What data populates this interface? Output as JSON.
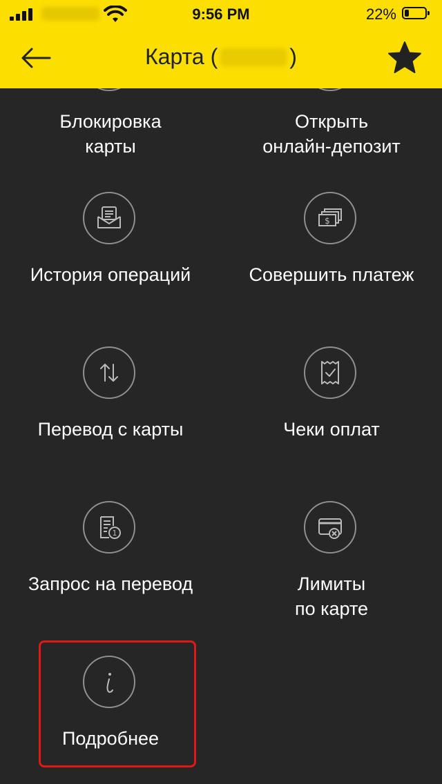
{
  "status_bar": {
    "time": "9:56 PM",
    "battery_percent": "22%",
    "battery_level": 0.22,
    "signal_icon": "cellular-signal-icon",
    "wifi_icon": "wifi-icon",
    "battery_icon": "battery-icon"
  },
  "header": {
    "title_prefix": "Карта (",
    "title_suffix": ")",
    "back_icon": "arrow-left-icon",
    "favorite_icon": "star-icon",
    "background_color": "#fcde00"
  },
  "actions": [
    {
      "id": "block-card",
      "label": "Блокировка\nкарты",
      "icon": "lock-icon"
    },
    {
      "id": "open-deposit",
      "label": "Открыть\nонлайн-депозит",
      "icon": "deposit-icon"
    },
    {
      "id": "history",
      "label": "История операций",
      "icon": "envelope-receipt-icon"
    },
    {
      "id": "payment",
      "label": "Совершить платеж",
      "icon": "banknotes-icon"
    },
    {
      "id": "transfer",
      "label": "Перевод с карты",
      "icon": "arrows-up-down-icon"
    },
    {
      "id": "receipts",
      "label": "Чеки оплат",
      "icon": "receipt-check-icon"
    },
    {
      "id": "transfer-request",
      "label": "Запрос на перевод",
      "icon": "request-document-icon"
    },
    {
      "id": "limits",
      "label": "Лимиты\nпо карте",
      "icon": "card-limit-icon"
    },
    {
      "id": "details",
      "label": "Подробнее",
      "icon": "info-icon"
    }
  ],
  "colors": {
    "background": "#262626",
    "icon_ring": "#8f8f8f",
    "text": "#ffffff",
    "highlight": "#e01818"
  }
}
